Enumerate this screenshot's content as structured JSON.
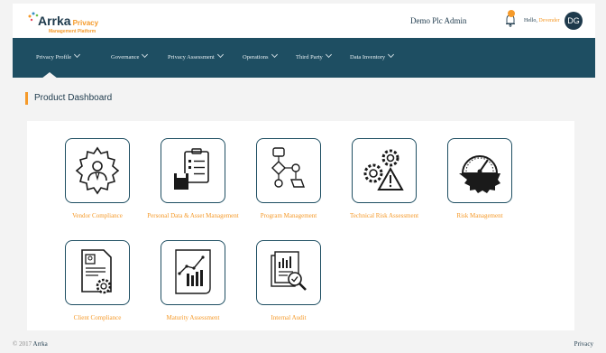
{
  "header": {
    "logo_name": "Arrka",
    "logo_privacy": "Privacy",
    "logo_sub": "Management Platform",
    "org_name": "Demo Plc Admin",
    "greeting": "Hello,",
    "user_name": "Devender",
    "avatar_initials": "DG"
  },
  "nav": {
    "items": [
      {
        "label": "Privacy Profile"
      },
      {
        "label": "Governance"
      },
      {
        "label": "Privacy Assessment"
      },
      {
        "label": "Operations"
      },
      {
        "label": "Third Party"
      },
      {
        "label": "Data Inventory"
      }
    ]
  },
  "page": {
    "title": "Product Dashboard"
  },
  "tiles": [
    {
      "label": "Vendor Compliance",
      "icon": "vendor-compliance-icon"
    },
    {
      "label": "Personal Data & Asset Management",
      "icon": "clipboard-database-icon"
    },
    {
      "label": "Program Management",
      "icon": "flowchart-icon"
    },
    {
      "label": "Technical Risk Assessment",
      "icon": "gears-warning-icon"
    },
    {
      "label": "Risk Management",
      "icon": "gauge-gear-icon"
    },
    {
      "label": "Client Compliance",
      "icon": "document-gear-icon"
    },
    {
      "label": "Maturity Assessment",
      "icon": "growth-chart-icon"
    },
    {
      "label": "Internal Audit",
      "icon": "audit-report-icon"
    }
  ],
  "footer": {
    "copyright": "© 2017",
    "brand": "Arrka",
    "privacy_link": "Privacy"
  },
  "colors": {
    "accent": "#f59a2a",
    "navy": "#1e4e62",
    "dark": "#1e3a4c"
  }
}
